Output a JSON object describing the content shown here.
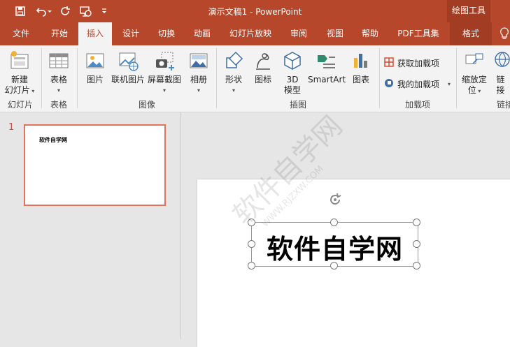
{
  "window": {
    "title": "演示文稿1  -  PowerPoint",
    "context_title": "绘图工具"
  },
  "tabs": [
    {
      "label": "文件"
    },
    {
      "label": "开始"
    },
    {
      "label": "插入"
    },
    {
      "label": "设计"
    },
    {
      "label": "切换"
    },
    {
      "label": "动画"
    },
    {
      "label": "幻灯片放映"
    },
    {
      "label": "审阅"
    },
    {
      "label": "视图"
    },
    {
      "label": "帮助"
    },
    {
      "label": "PDF工具集"
    },
    {
      "label": "格式"
    }
  ],
  "ribbon": {
    "slides": {
      "new_slide_l1": "新建",
      "new_slide_l2": "幻灯片",
      "group": "幻灯片"
    },
    "tables": {
      "table": "表格",
      "group": "表格"
    },
    "images": {
      "picture": "图片",
      "online_picture": "联机图片",
      "screenshot": "屏幕截图",
      "album": "相册",
      "group": "图像"
    },
    "illustrations": {
      "shapes": "形状",
      "icons": "图标",
      "model_l1": "3D",
      "model_l2": "模型",
      "smartart": "SmartArt",
      "chart": "图表",
      "group": "插图"
    },
    "addins": {
      "get_addins": "获取加载项",
      "my_addins": "我的加载项",
      "group": "加载项"
    },
    "links": {
      "zoom_l1": "缩放定",
      "zoom_l2": "位",
      "link_l1": "链",
      "link_l2": "接",
      "group": "链接"
    }
  },
  "thumbnails": [
    {
      "number": "1",
      "text": "软件自学网"
    }
  ],
  "slide": {
    "textbox_text": "软件自学网"
  },
  "watermark": {
    "text": "软件自学网",
    "url": "WWW.RJZXW.COM"
  },
  "colors": {
    "accent": "#b7472a",
    "context_tab": "#a23d24",
    "ribbon_bg": "#f3f3f3",
    "thumb_border": "#e0735a"
  }
}
